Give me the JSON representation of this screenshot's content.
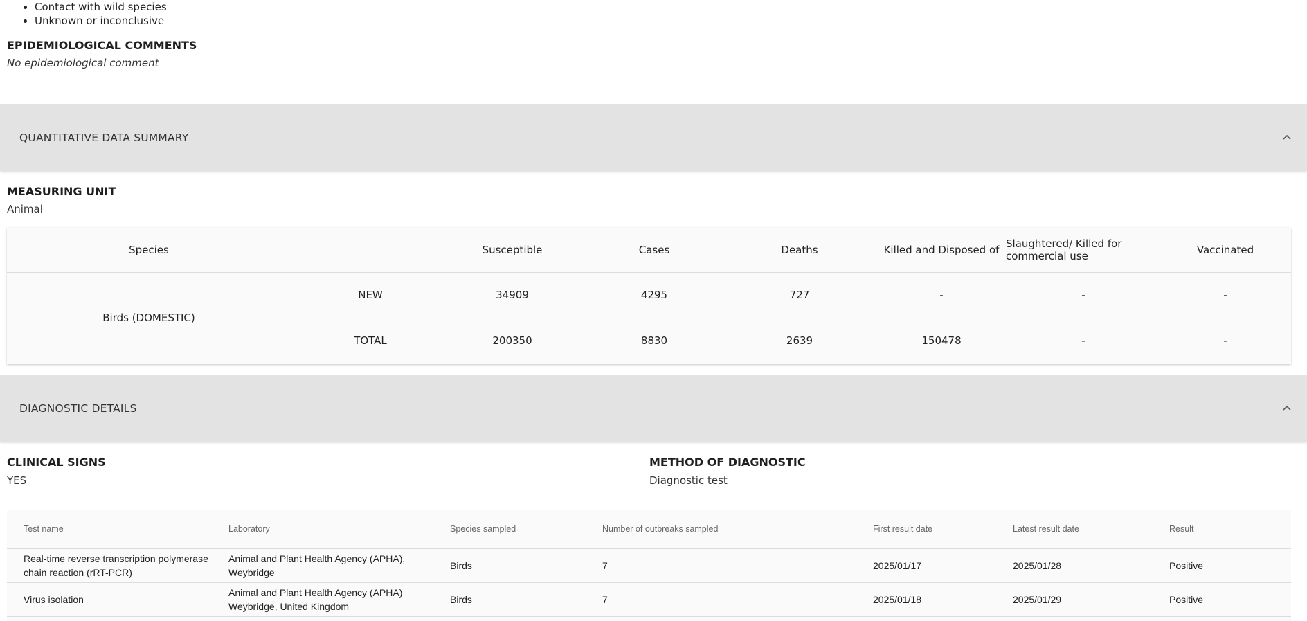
{
  "top_list": [
    "Contact with wild species",
    "Unknown or inconclusive"
  ],
  "epidemiological": {
    "title": "EPIDEMIOLOGICAL COMMENTS",
    "value": "No epidemiological comment"
  },
  "quantitative_panel": {
    "title": "QUANTITATIVE DATA SUMMARY",
    "icon": "chevron-up-icon"
  },
  "measuring_unit": {
    "title": "MEASURING UNIT",
    "value": "Animal"
  },
  "quantitative_table": {
    "headers": [
      "Species",
      "Susceptible",
      "Cases",
      "Deaths",
      "Killed and Disposed of",
      "Slaughtered/ Killed for commercial use",
      "Vaccinated"
    ],
    "species": "Birds (DOMESTIC)",
    "rows": [
      {
        "label": "NEW",
        "susceptible": "34909",
        "cases": "4295",
        "deaths": "727",
        "killed": "-",
        "slaughtered": "-",
        "vaccinated": "-"
      },
      {
        "label": "TOTAL",
        "susceptible": "200350",
        "cases": "8830",
        "deaths": "2639",
        "killed": "150478",
        "slaughtered": "-",
        "vaccinated": "-"
      }
    ]
  },
  "diagnostic_panel": {
    "title": "DIAGNOSTIC DETAILS",
    "icon": "chevron-up-icon"
  },
  "clinical_signs": {
    "title": "CLINICAL SIGNS",
    "value": "YES"
  },
  "method_of_diagnostic": {
    "title": "METHOD OF DIAGNOSTIC",
    "value": "Diagnostic test"
  },
  "diagnostic_table": {
    "headers": [
      "Test name",
      "Laboratory",
      "Species sampled",
      "Number of outbreaks sampled",
      "First result date",
      "Latest result date",
      "Result"
    ],
    "rows": [
      {
        "test_name": "Real-time reverse transcription polymerase chain reaction (rRT-PCR)",
        "laboratory": "Animal and Plant Health Agency (APHA), Weybridge",
        "species": "Birds",
        "outbreaks": "7",
        "first_date": "2025/01/17",
        "latest_date": "2025/01/28",
        "result": "Positive"
      },
      {
        "test_name": "Virus isolation",
        "laboratory": "Animal and Plant Health Agency (APHA) Weybridge, United Kingdom",
        "species": "Birds",
        "outbreaks": "7",
        "first_date": "2025/01/18",
        "latest_date": "2025/01/29",
        "result": "Positive"
      }
    ]
  }
}
